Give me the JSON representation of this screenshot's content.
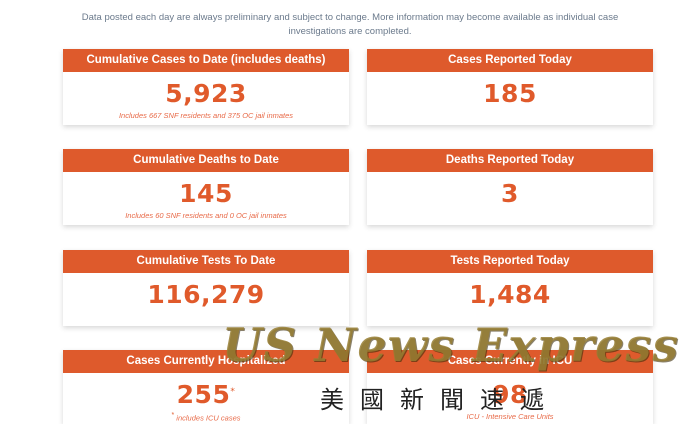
{
  "notice": "Data posted each day are always preliminary and subject to change. More information may become available as individual case investigations are completed.",
  "cards": [
    {
      "title": "Cumulative Cases to Date (includes deaths)",
      "value": "5,923",
      "note": "Includes 667 SNF residents and 375 OC jail inmates"
    },
    {
      "title": "Cases Reported Today",
      "value": "185",
      "note": ""
    },
    {
      "title": "Cumulative Deaths to Date",
      "value": "145",
      "note": "Includes 60 SNF residents and 0 OC jail inmates"
    },
    {
      "title": "Deaths Reported Today",
      "value": "3",
      "note": ""
    },
    {
      "title": "Cumulative Tests To Date",
      "value": "116,279",
      "note": ""
    },
    {
      "title": "Tests Reported Today",
      "value": "1,484",
      "note": ""
    },
    {
      "title": "Cases Currently Hospitalized",
      "value": "255",
      "value_mark": "*",
      "note_mark": "*",
      "note": " includes ICU cases"
    },
    {
      "title": "Cases Currently in ICU",
      "value": "98",
      "note": "ICU - Intensive Care Units"
    }
  ],
  "watermark": {
    "english": "US News Express",
    "chinese": "美國新聞速遞"
  },
  "colors": {
    "header": "#de5a2c",
    "value": "#e05a2b",
    "notice": "#6b7a8c"
  }
}
